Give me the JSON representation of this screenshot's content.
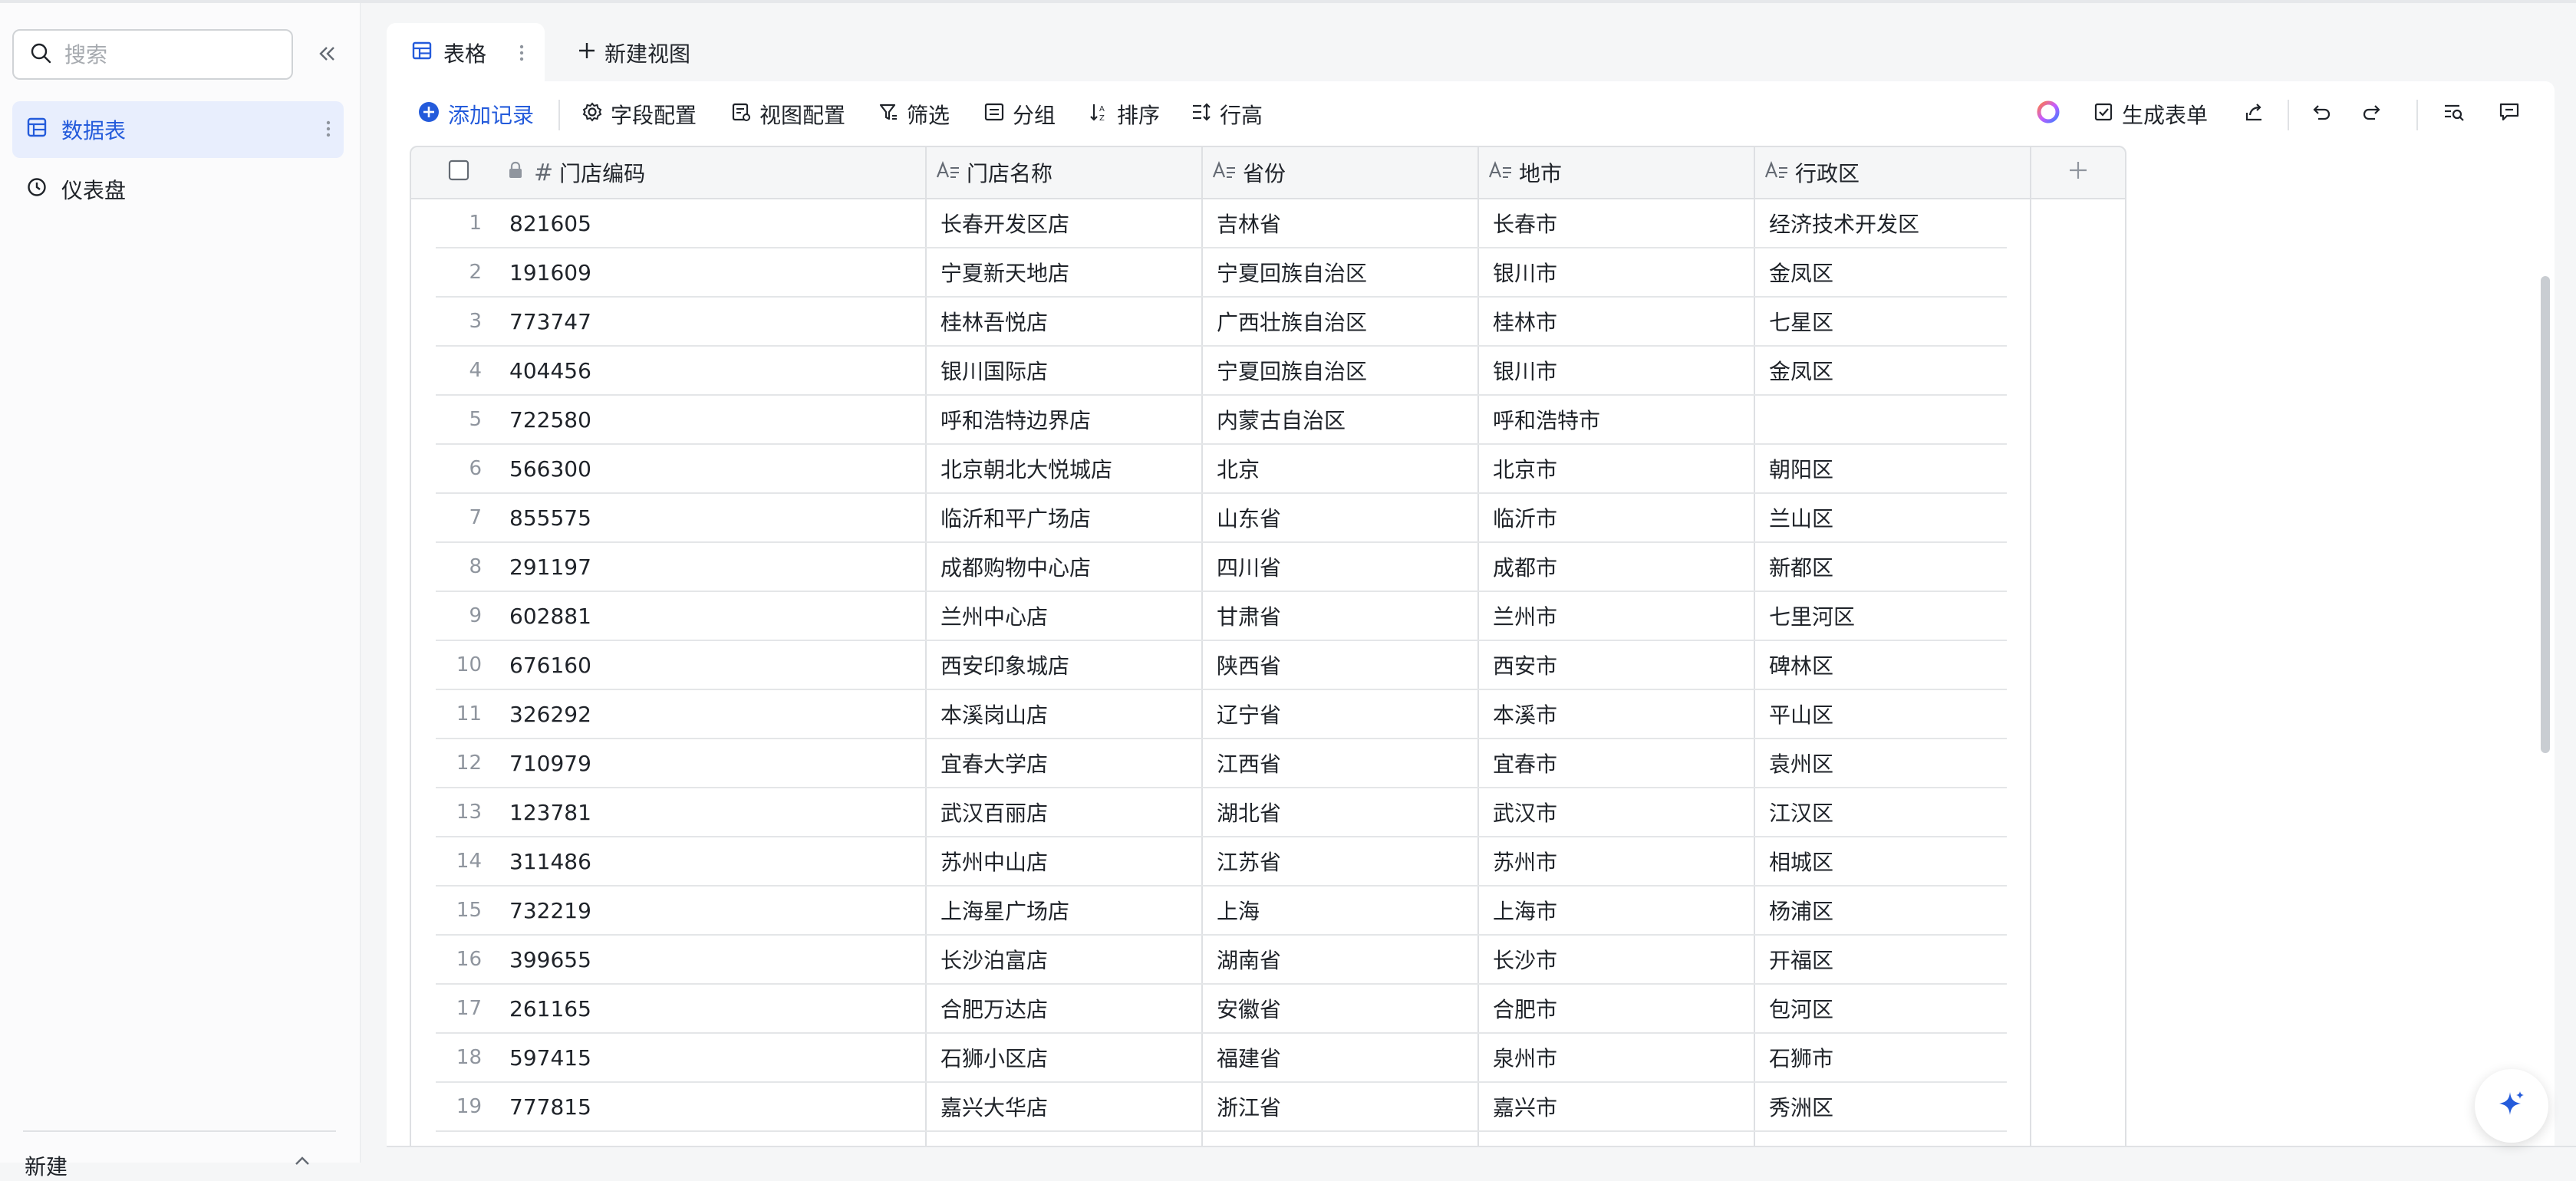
{
  "sidebar": {
    "search_placeholder": "搜索",
    "items": [
      {
        "label": "数据表",
        "active": true
      },
      {
        "label": "仪表盘",
        "active": false
      }
    ],
    "bottom_label": "新建"
  },
  "tabs": {
    "active_label": "表格",
    "new_view_label": "新建视图"
  },
  "toolbar": {
    "add_record": "添加记录",
    "field_config": "字段配置",
    "view_config": "视图配置",
    "filter": "筛选",
    "group": "分组",
    "sort": "排序",
    "row_height": "行高",
    "generate_form": "生成表单"
  },
  "columns": {
    "code": "门店编码",
    "name": "门店名称",
    "province": "省份",
    "city": "地市",
    "district": "行政区"
  },
  "rows": [
    {
      "num": "1",
      "code": "821605",
      "name": "长春开发区店",
      "province": "吉林省",
      "city": "长春市",
      "district": "经济技术开发区"
    },
    {
      "num": "2",
      "code": "191609",
      "name": "宁夏新天地店",
      "province": "宁夏回族自治区",
      "city": "银川市",
      "district": "金凤区"
    },
    {
      "num": "3",
      "code": "773747",
      "name": "桂林吾悦店",
      "province": "广西壮族自治区",
      "city": "桂林市",
      "district": "七星区"
    },
    {
      "num": "4",
      "code": "404456",
      "name": "银川国际店",
      "province": "宁夏回族自治区",
      "city": "银川市",
      "district": "金凤区"
    },
    {
      "num": "5",
      "code": "722580",
      "name": "呼和浩特边界店",
      "province": "内蒙古自治区",
      "city": "呼和浩特市",
      "district": ""
    },
    {
      "num": "6",
      "code": "566300",
      "name": "北京朝北大悦城店",
      "province": "北京",
      "city": "北京市",
      "district": "朝阳区"
    },
    {
      "num": "7",
      "code": "855575",
      "name": "临沂和平广场店",
      "province": "山东省",
      "city": "临沂市",
      "district": "兰山区"
    },
    {
      "num": "8",
      "code": "291197",
      "name": "成都购物中心店",
      "province": "四川省",
      "city": "成都市",
      "district": "新都区"
    },
    {
      "num": "9",
      "code": "602881",
      "name": "兰州中心店",
      "province": "甘肃省",
      "city": "兰州市",
      "district": "七里河区"
    },
    {
      "num": "10",
      "code": "676160",
      "name": "西安印象城店",
      "province": "陕西省",
      "city": "西安市",
      "district": "碑林区"
    },
    {
      "num": "11",
      "code": "326292",
      "name": "本溪岗山店",
      "province": "辽宁省",
      "city": "本溪市",
      "district": "平山区"
    },
    {
      "num": "12",
      "code": "710979",
      "name": "宜春大学店",
      "province": "江西省",
      "city": "宜春市",
      "district": "袁州区"
    },
    {
      "num": "13",
      "code": "123781",
      "name": "武汉百丽店",
      "province": "湖北省",
      "city": "武汉市",
      "district": "江汉区"
    },
    {
      "num": "14",
      "code": "311486",
      "name": "苏州中山店",
      "province": "江苏省",
      "city": "苏州市",
      "district": "相城区"
    },
    {
      "num": "15",
      "code": "732219",
      "name": "上海星广场店",
      "province": "上海",
      "city": "上海市",
      "district": "杨浦区"
    },
    {
      "num": "16",
      "code": "399655",
      "name": "长沙泊富店",
      "province": "湖南省",
      "city": "长沙市",
      "district": "开福区"
    },
    {
      "num": "17",
      "code": "261165",
      "name": "合肥万达店",
      "province": "安徽省",
      "city": "合肥市",
      "district": "包河区"
    },
    {
      "num": "18",
      "code": "597415",
      "name": "石狮小区店",
      "province": "福建省",
      "city": "泉州市",
      "district": "石狮市"
    },
    {
      "num": "19",
      "code": "777815",
      "name": "嘉兴大华店",
      "province": "浙江省",
      "city": "嘉兴市",
      "district": "秀洲区"
    }
  ],
  "colors": {
    "accent": "#245bdb",
    "active_bg": "#e8eefd",
    "grid_line": "#dee0e3",
    "muted": "#8f959e"
  },
  "icons": {
    "search": "search-icon",
    "collapse": "double-chevron-left-icon",
    "table": "table-icon",
    "dashboard": "dashboard-icon",
    "add": "plus-circle-icon",
    "gear": "gear-icon",
    "filter": "filter-icon",
    "group": "group-icon",
    "sort": "sort-icon",
    "row_height": "row-height-icon",
    "form": "form-icon",
    "share": "share-icon",
    "undo": "undo-icon",
    "redo": "redo-icon",
    "find": "find-icon",
    "comment": "comment-icon",
    "ai": "sparkle-icon",
    "lock": "lock-icon"
  }
}
